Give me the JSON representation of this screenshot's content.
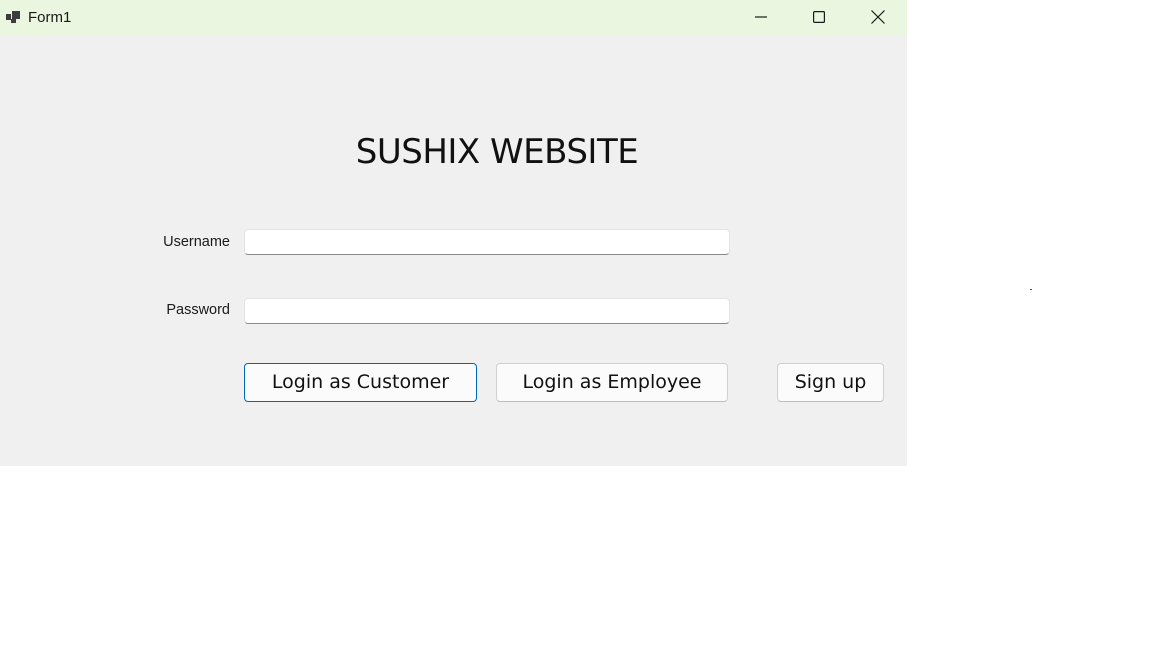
{
  "window": {
    "title": "Form1",
    "icons": {
      "app": "form-app-icon",
      "minimize": "minimize-icon",
      "maximize": "maximize-icon",
      "close": "close-icon"
    },
    "colors": {
      "titlebar": "#eaf6df",
      "body": "#f0f0f0",
      "accent": "#0067c0"
    }
  },
  "form": {
    "heading": "SUSHIX WEBSITE",
    "username_label": "Username",
    "username_value": "",
    "password_label": "Password",
    "password_value": "",
    "buttons": {
      "customer": "Login as Customer",
      "employee": "Login as Employee",
      "signup": "Sign up"
    }
  }
}
